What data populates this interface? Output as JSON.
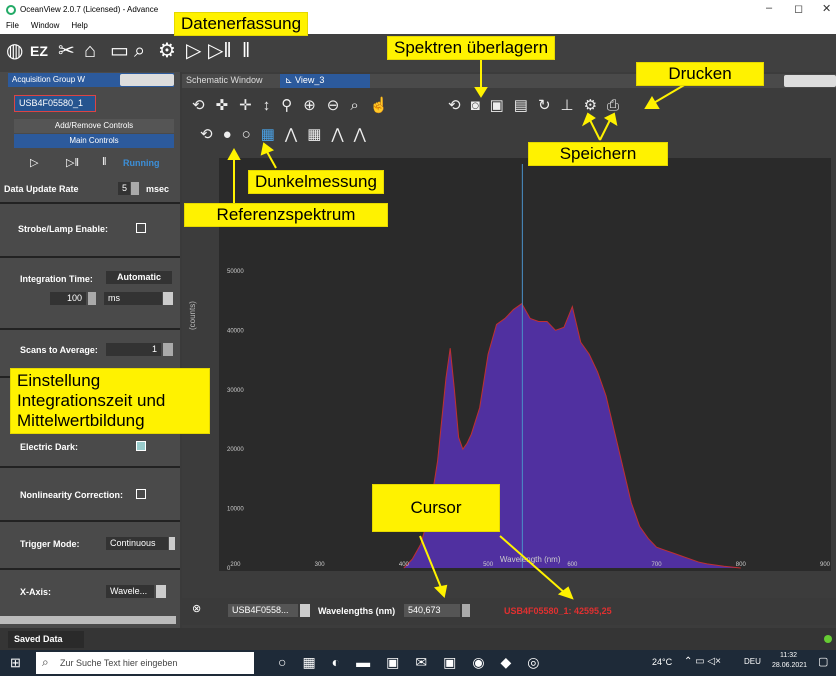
{
  "window": {
    "title": "OceanView 2.0.7 (Licensed) - Advance",
    "controls": [
      "–",
      "◻",
      "✕"
    ]
  },
  "menu": [
    "File",
    "Window",
    "Help"
  ],
  "callouts": {
    "datenerfassung": "Datenerfassung",
    "spektren": "Spektren überlagern",
    "drucken": "Drucken",
    "speichern": "Speichern",
    "dunkel": "Dunkelmessung",
    "referenz": "Referenzspektrum",
    "einstellung1": "Einstellung",
    "einstellung2": "Integrationszeit und",
    "einstellung3": "Mittelwertbildung",
    "cursor": "Cursor"
  },
  "left": {
    "tab": "Acquisition Group W",
    "device": "USB4F05580_1",
    "add_remove": "Add/Remove Controls",
    "main_controls": "Main Controls",
    "running": "Running",
    "update_rate_label": "Data Update Rate",
    "update_rate_value": "5",
    "update_rate_unit": "msec",
    "strobe": "Strobe/Lamp Enable:",
    "integration_label": "Integration Time:",
    "integration_mode": "Automatic",
    "integration_value": "100",
    "integration_unit": "ms",
    "scans_label": "Scans to Average:",
    "scans_value": "1",
    "electric_dark": "Electric Dark:",
    "nonlinearity": "Nonlinearity Correction:",
    "trigger_label": "Trigger Mode:",
    "trigger_value": "Continuous",
    "xaxis_label": "X-Axis:",
    "xaxis_value": "Wavele...",
    "saved": "Saved Data"
  },
  "tabs": {
    "schematic": "Schematic Window",
    "view": "View_3"
  },
  "status": {
    "device": "USB4F0558...",
    "wl_label": "Wavelengths (nm)",
    "wl_value": "540,673",
    "readout": "USB4F05580_1: 42595,25"
  },
  "taskbar": {
    "search": "Zur Suche Text hier eingeben",
    "temp": "24°C",
    "lang": "DEU",
    "time": "11:32",
    "date": "28.06.2021"
  },
  "chart_data": {
    "type": "area",
    "xlabel": "Wavelength (nm)",
    "ylabel": "(counts)",
    "xlim": [
      190,
      900
    ],
    "ylim": [
      0,
      68000
    ],
    "xticks": [
      200,
      300,
      400,
      500,
      600,
      700,
      800,
      900
    ],
    "yticks": [
      0,
      10000,
      20000,
      30000,
      40000,
      50000,
      60000
    ],
    "cursor_x": 540.673,
    "x": [
      400,
      410,
      420,
      430,
      440,
      450,
      455,
      460,
      465,
      470,
      475,
      480,
      490,
      500,
      510,
      520,
      530,
      540,
      550,
      560,
      570,
      580,
      590,
      600,
      610,
      620,
      630,
      640,
      650,
      660,
      670,
      680,
      690,
      700,
      710,
      720,
      730,
      740,
      750,
      760,
      780,
      800
    ],
    "values": [
      0,
      1500,
      4000,
      9000,
      18000,
      32000,
      37000,
      30000,
      22000,
      20000,
      21000,
      22500,
      27000,
      36000,
      41000,
      42000,
      43500,
      44500,
      42000,
      41500,
      41500,
      40000,
      40500,
      44000,
      38000,
      36000,
      33000,
      29000,
      23000,
      17000,
      11000,
      7000,
      5000,
      3500,
      3000,
      2500,
      2000,
      1500,
      1000,
      700,
      300,
      0
    ]
  }
}
